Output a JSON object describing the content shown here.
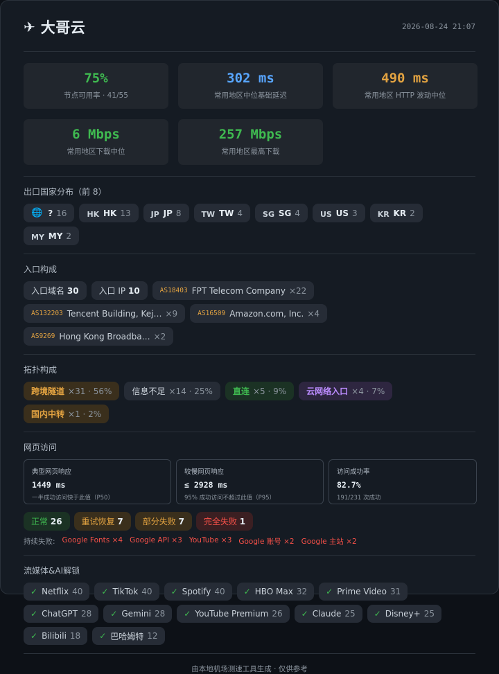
{
  "header": {
    "title": "大哥云",
    "timestamp": "2026-08-24 21:07"
  },
  "metrics": [
    {
      "value": "75%",
      "label": "节点可用率 · 41/55",
      "color": "#3fb950"
    },
    {
      "value": "302 ms",
      "label": "常用地区中位基础延迟",
      "color": "#58a6ff"
    },
    {
      "value": "490 ms",
      "label": "常用地区 HTTP 波动中位",
      "color": "#e3a341"
    },
    {
      "value": "6 Mbps",
      "label": "常用地区下载中位",
      "color": "#3fb950"
    },
    {
      "value": "257 Mbps",
      "label": "常用地区最高下载",
      "color": "#3fb950"
    }
  ],
  "exit_countries": {
    "title": "出口国家分布（前 8）",
    "items": [
      {
        "flag": "",
        "code": "?",
        "count": "16"
      },
      {
        "flag": "HK",
        "code": "HK",
        "count": "13"
      },
      {
        "flag": "JP",
        "code": "JP",
        "count": "8"
      },
      {
        "flag": "TW",
        "code": "TW",
        "count": "4"
      },
      {
        "flag": "SG",
        "code": "SG",
        "count": "4"
      },
      {
        "flag": "US",
        "code": "US",
        "count": "3"
      },
      {
        "flag": "KR",
        "code": "KR",
        "count": "2"
      },
      {
        "flag": "MY",
        "code": "MY",
        "count": "2"
      }
    ]
  },
  "entry": {
    "title": "入口构成",
    "domain_label": "入口域名",
    "domain_count": "30",
    "ip_label": "入口 IP",
    "ip_count": "10",
    "asns": [
      {
        "asn": "AS18403",
        "name": "FPT Telecom Company",
        "count": "×22"
      },
      {
        "asn": "AS132203",
        "name": "Tencent Building, Kej…",
        "count": "×9"
      },
      {
        "asn": "AS16509",
        "name": "Amazon.com, Inc.",
        "count": "×4"
      },
      {
        "asn": "AS9269",
        "name": "Hong Kong Broadba…",
        "count": "×2"
      }
    ]
  },
  "topology": {
    "title": "拓扑构成",
    "items": [
      {
        "label": "跨境隧道",
        "stat": "×31 · 56%"
      },
      {
        "label": "信息不足",
        "stat": "×14 · 25%"
      },
      {
        "label": "直连",
        "stat": "×5 · 9%"
      },
      {
        "label": "云网络入口",
        "stat": "×4 · 7%"
      },
      {
        "label": "国内中转",
        "stat": "×1 · 2%"
      }
    ]
  },
  "web": {
    "title": "网页访问",
    "cards": [
      {
        "head": "典型网页响应",
        "value": "1449 ms",
        "sub": "一半成功访问快于此值（P50）"
      },
      {
        "head": "较慢网页响应",
        "value": "≤ 2928 ms",
        "sub": "95% 成功访问不超过此值（P95）"
      },
      {
        "head": "访问成功率",
        "value": "82.7%",
        "sub": "191/231 次成功"
      }
    ],
    "status": [
      {
        "label": "正常",
        "count": "26"
      },
      {
        "label": "重试恢复",
        "count": "7"
      },
      {
        "label": "部分失败",
        "count": "7"
      },
      {
        "label": "完全失败",
        "count": "1"
      }
    ],
    "persist_label": "持续失败:",
    "persist": [
      "Google Fonts ×4",
      "Google API ×3",
      "YouTube ×3",
      "Google 账号 ×2",
      "Google 主站 ×2"
    ]
  },
  "media": {
    "title": "流媒体&AI解锁",
    "items": [
      {
        "name": "Netflix",
        "count": "40"
      },
      {
        "name": "TikTok",
        "count": "40"
      },
      {
        "name": "Spotify",
        "count": "40"
      },
      {
        "name": "HBO Max",
        "count": "32"
      },
      {
        "name": "Prime Video",
        "count": "31"
      },
      {
        "name": "ChatGPT",
        "count": "28"
      },
      {
        "name": "Gemini",
        "count": "28"
      },
      {
        "name": "YouTube Premium",
        "count": "26"
      },
      {
        "name": "Claude",
        "count": "25"
      },
      {
        "name": "Disney+",
        "count": "25"
      },
      {
        "name": "Bilibili",
        "count": "18"
      },
      {
        "name": "巴哈姆特",
        "count": "12"
      }
    ]
  },
  "footer": "由本地机场测速工具生成 · 仅供参考"
}
